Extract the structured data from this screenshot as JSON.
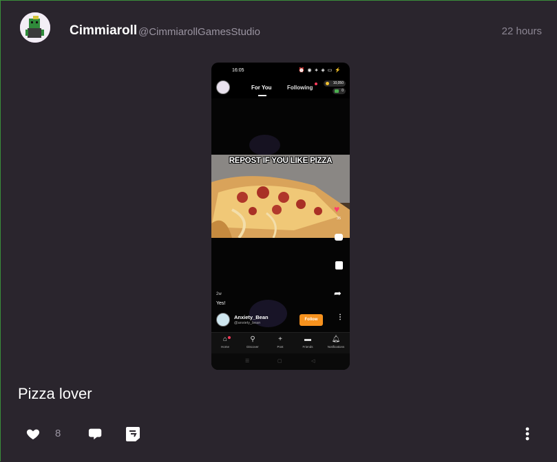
{
  "post": {
    "author_name": "Cimmiaroll",
    "author_handle": "@CimmiarollGamesStudio",
    "time": "22 hours",
    "caption": "Pizza lover",
    "like_count": "8"
  },
  "screenshot": {
    "status_time": "16:05",
    "status_icons": "⏰ ◉ ∗ ◈ ▭ ⚡",
    "tab_for_you": "For You",
    "tab_following": "Following",
    "coins": "10,050",
    "cash": "0",
    "meme_caption": "REPOST IF YOU LIKE PIZZA",
    "heart_count": "35",
    "post_age": "2w",
    "post_text": "Yes!",
    "creator_name": "Anxiety_Bean",
    "creator_handle": "@anxiety_bean",
    "follow_label": "Follow",
    "nav": [
      {
        "label": "Home",
        "icon": "home-icon"
      },
      {
        "label": "Discover",
        "icon": "search-icon"
      },
      {
        "label": "Post",
        "icon": "plus-icon"
      },
      {
        "label": "Friends",
        "icon": "chat-icon"
      },
      {
        "label": "Notifications",
        "icon": "bell-icon"
      }
    ],
    "system_nav": [
      "☰",
      "▢",
      "◁"
    ]
  },
  "colors": {
    "background": "#2a252d",
    "accent_heart": "#ff3d6b",
    "follow_button": "#f7921e",
    "muted_text": "#9a94a1"
  }
}
